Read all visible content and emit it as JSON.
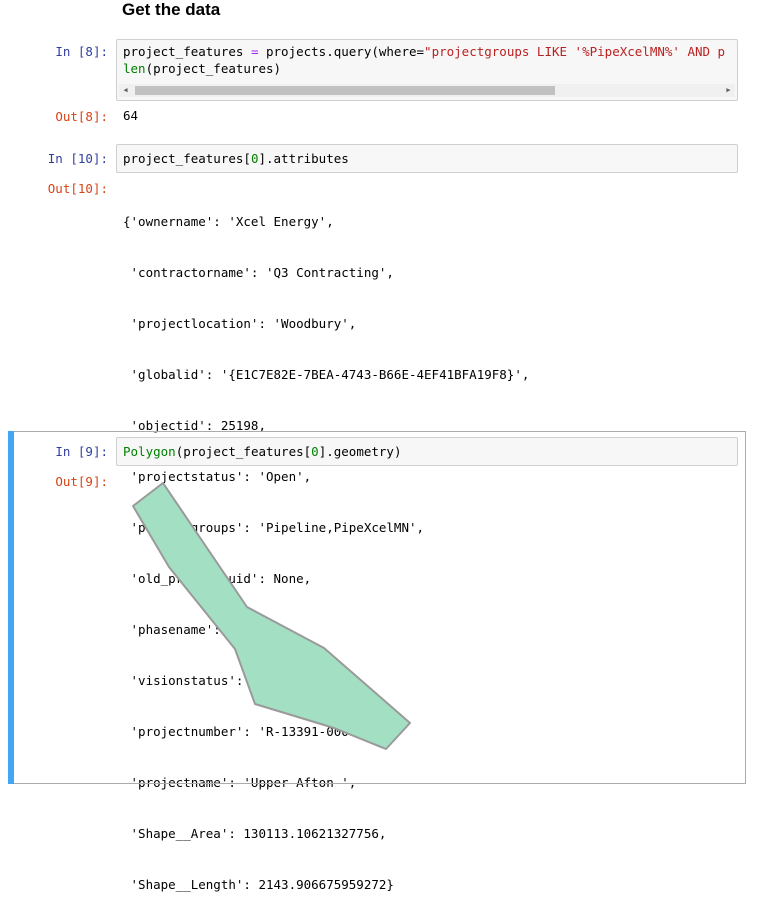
{
  "heading": "Get the data",
  "cell8": {
    "in_prompt": "In [8]:",
    "line1_a": "project_features ",
    "line1_eq": "=",
    "line1_b": " projects.query(where=",
    "line1_str": "\"projectgroups LIKE '%PipeXcelMN%' AND p",
    "line2_fn": "len",
    "line2_rest": "(project_features)",
    "out_prompt": "Out[8]:",
    "out_value": "64"
  },
  "cell10": {
    "in_prompt": "In [10]:",
    "code_a": "project_features[",
    "code_num": "0",
    "code_b": "].attributes",
    "out_prompt": "Out[10]:",
    "out_lines": [
      "{'ownername': 'Xcel Energy',",
      " 'contractorname': 'Q3 Contracting',",
      " 'projectlocation': 'Woodbury',",
      " 'globalid': '{E1C7E82E-7BEA-4743-B66E-4EF41BFA19F8}',",
      " 'objectid': 25198,",
      " 'projectstatus': 'Open',",
      " 'projectgroups': 'Pipeline,PipeXcelMN',",
      " 'old_projectguid': None,",
      " 'phasename': '096',",
      " 'visionstatus': None,",
      " 'projectnumber': 'R-13391-000',",
      " 'projectname': 'Upper Afton ',",
      " 'Shape__Area': 130113.10621327756,",
      " 'Shape__Length': 2143.906675959272}"
    ]
  },
  "cell9": {
    "in_prompt": "In [9]:",
    "code_fn": "Polygon",
    "code_a": "(project_features[",
    "code_num": "0",
    "code_b": "].geometry)",
    "out_prompt": "Out[9]:"
  },
  "colors": {
    "polygon_fill": "#a3dfc2",
    "polygon_stroke": "#9a9a9a",
    "selected_bar": "#42a5f5"
  },
  "scrollbar": {
    "left_arrow": "◀",
    "right_arrow": "▶"
  }
}
